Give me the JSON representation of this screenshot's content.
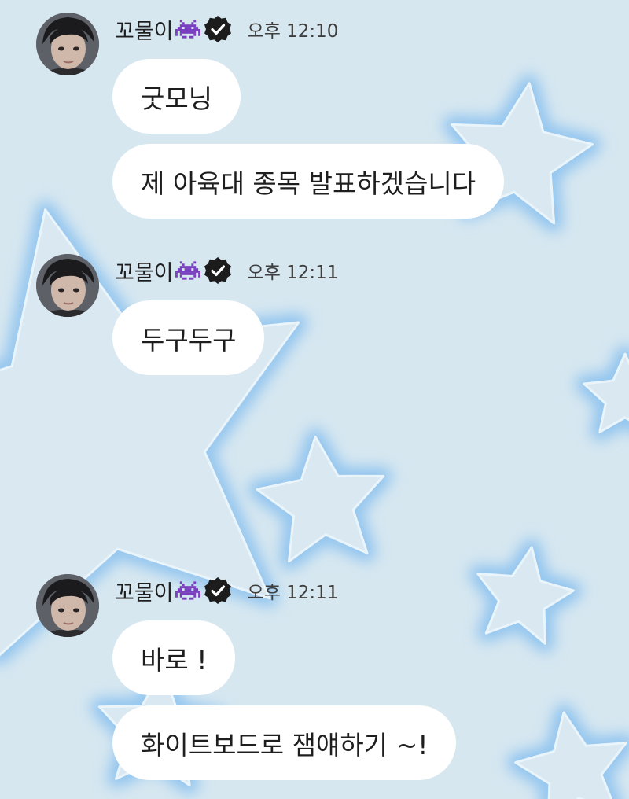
{
  "messages": [
    {
      "sender": "꼬물이",
      "time": "오후 12:10",
      "bubbles": [
        "굿모닝",
        "제 아육대 종목 발표하겠습니다"
      ]
    },
    {
      "sender": "꼬물이",
      "time": "오후 12:11",
      "bubbles": [
        "두구두구"
      ]
    },
    {
      "sender": "꼬물이",
      "time": "오후 12:11",
      "bubbles": [
        "바로 !",
        "화이트보드로 잼얘하기 ~!"
      ]
    }
  ],
  "icons": {
    "sender_badge": "alien-monster-icon",
    "verified": "verified-badge-icon"
  },
  "colors": {
    "background": "#d6e7f0",
    "bubble": "#ffffff",
    "verified_badge": "#1c1c1c",
    "alien_icon": "#7a3fbf"
  }
}
